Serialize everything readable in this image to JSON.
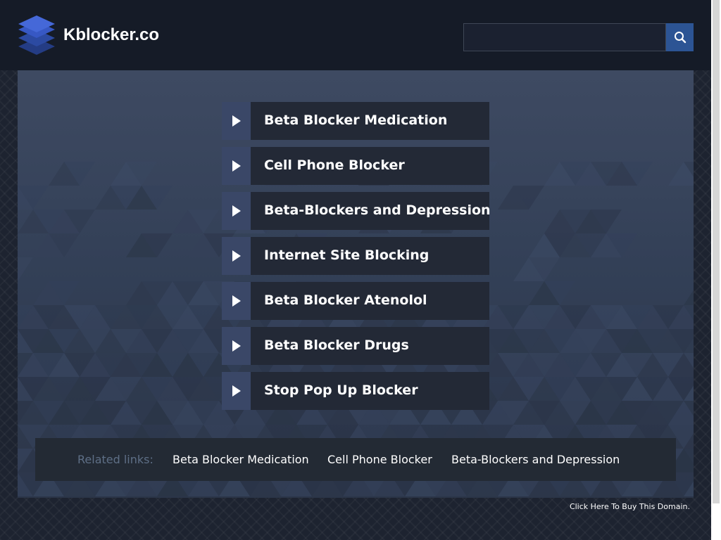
{
  "header": {
    "site_title": "Kblocker.co",
    "logo_icon": "stacked-layers-icon",
    "search": {
      "value": "",
      "button_icon": "search-icon"
    }
  },
  "ads": [
    {
      "label": "Beta Blocker Medication",
      "icon": "triangle-right-icon"
    },
    {
      "label": "Cell Phone Blocker",
      "icon": "triangle-right-icon"
    },
    {
      "label": "Beta-Blockers and Depression",
      "icon": "triangle-right-icon"
    },
    {
      "label": "Internet Site Blocking",
      "icon": "triangle-right-icon"
    },
    {
      "label": "Beta Blocker Atenolol",
      "icon": "triangle-right-icon"
    },
    {
      "label": "Beta Blocker Drugs",
      "icon": "triangle-right-icon"
    },
    {
      "label": "Stop Pop Up Blocker",
      "icon": "triangle-right-icon"
    }
  ],
  "related": {
    "heading": "Related links:",
    "links": [
      "Beta Blocker Medication",
      "Cell Phone Blocker",
      "Beta-Blockers and Depression"
    ]
  },
  "footer": {
    "buy_domain": "Click Here To Buy This Domain."
  },
  "colors": {
    "header_bg": "#151b27",
    "panel_bg": "#344058",
    "ad_bg": "#232936",
    "ad_arrow_bg": "#3a4767",
    "search_button": "#2c5494",
    "related_heading": "#5e6f86"
  }
}
